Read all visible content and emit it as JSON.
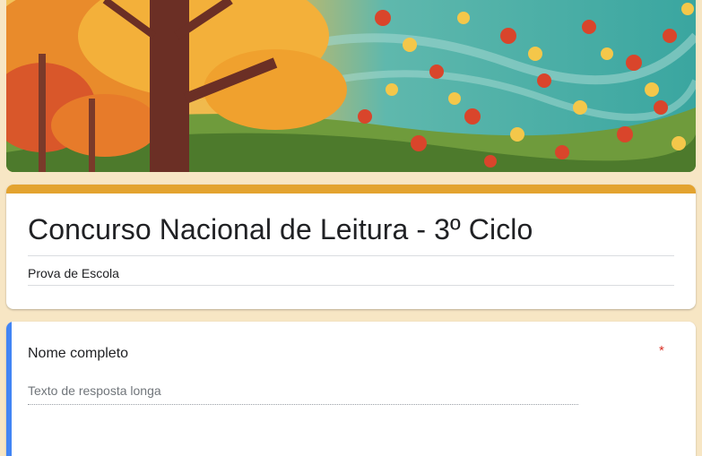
{
  "colors": {
    "accent": "#e3a32f",
    "focus": "#4285f4",
    "required": "#d93025",
    "page_background": "#f7e6c4"
  },
  "header": {
    "image": "autumn-leaves-banner"
  },
  "form": {
    "title": "Concurso Nacional de Leitura - 3º Ciclo",
    "description": "Prova de Escola"
  },
  "question": {
    "label": "Nome completo",
    "required_marker": "*",
    "placeholder": "Texto de resposta longa"
  }
}
